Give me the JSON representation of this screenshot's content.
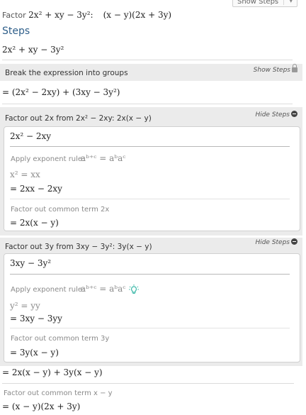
{
  "header": {
    "factor_label": "Factor",
    "problem": "2x² + xy − 3y²:",
    "answer": "(x − y)(2x + 3y)",
    "show_steps_button": "Show Steps"
  },
  "steps_title": "Steps",
  "initial_expression": "2x² + xy − 3y²",
  "step_groups": {
    "title": "Break the expression into groups",
    "link": "Show Steps",
    "result": "= (2x² − 2xy) + (3xy − 3y²)"
  },
  "step1": {
    "title": "Factor out 2x from 2x² − 2xy:   2x(x − y)",
    "link": "Hide Steps",
    "expr": "2x² − 2xy",
    "rule_label": "Apply exponent rule:",
    "rule_formula": "aᵇ⁺ᶜ = aᵇaᶜ",
    "rule_line": "x² = xx",
    "after_rule": "= 2xx − 2xy",
    "common_label": "Factor out common term 2x",
    "common_result": "= 2x(x − y)"
  },
  "step2": {
    "title": "Factor out 3y from 3xy − 3y²:   3y(x − y)",
    "link": "Hide Steps",
    "expr": "3xy − 3y²",
    "rule_label": "Apply exponent rule:",
    "rule_formula": "aᵇ⁺ᶜ = aᵇaᶜ",
    "rule_line": "y² = yy",
    "after_rule": "= 3xy − 3yy",
    "common_label": "Factor out common term 3y",
    "common_result": "= 3y(x − y)"
  },
  "combined": "= 2x(x − y) + 3y(x − y)",
  "final_label": "Factor out common term x − y",
  "final_result": "= (x − y)(2x + 3y)",
  "colors": {
    "bar_bg": "#ebebeb",
    "title_blue": "#2f5f8a",
    "bulb": "#3bb8a8"
  },
  "icons": [
    "lock-icon",
    "minus-circle-icon",
    "lightbulb-icon",
    "chevron-down-icon"
  ]
}
